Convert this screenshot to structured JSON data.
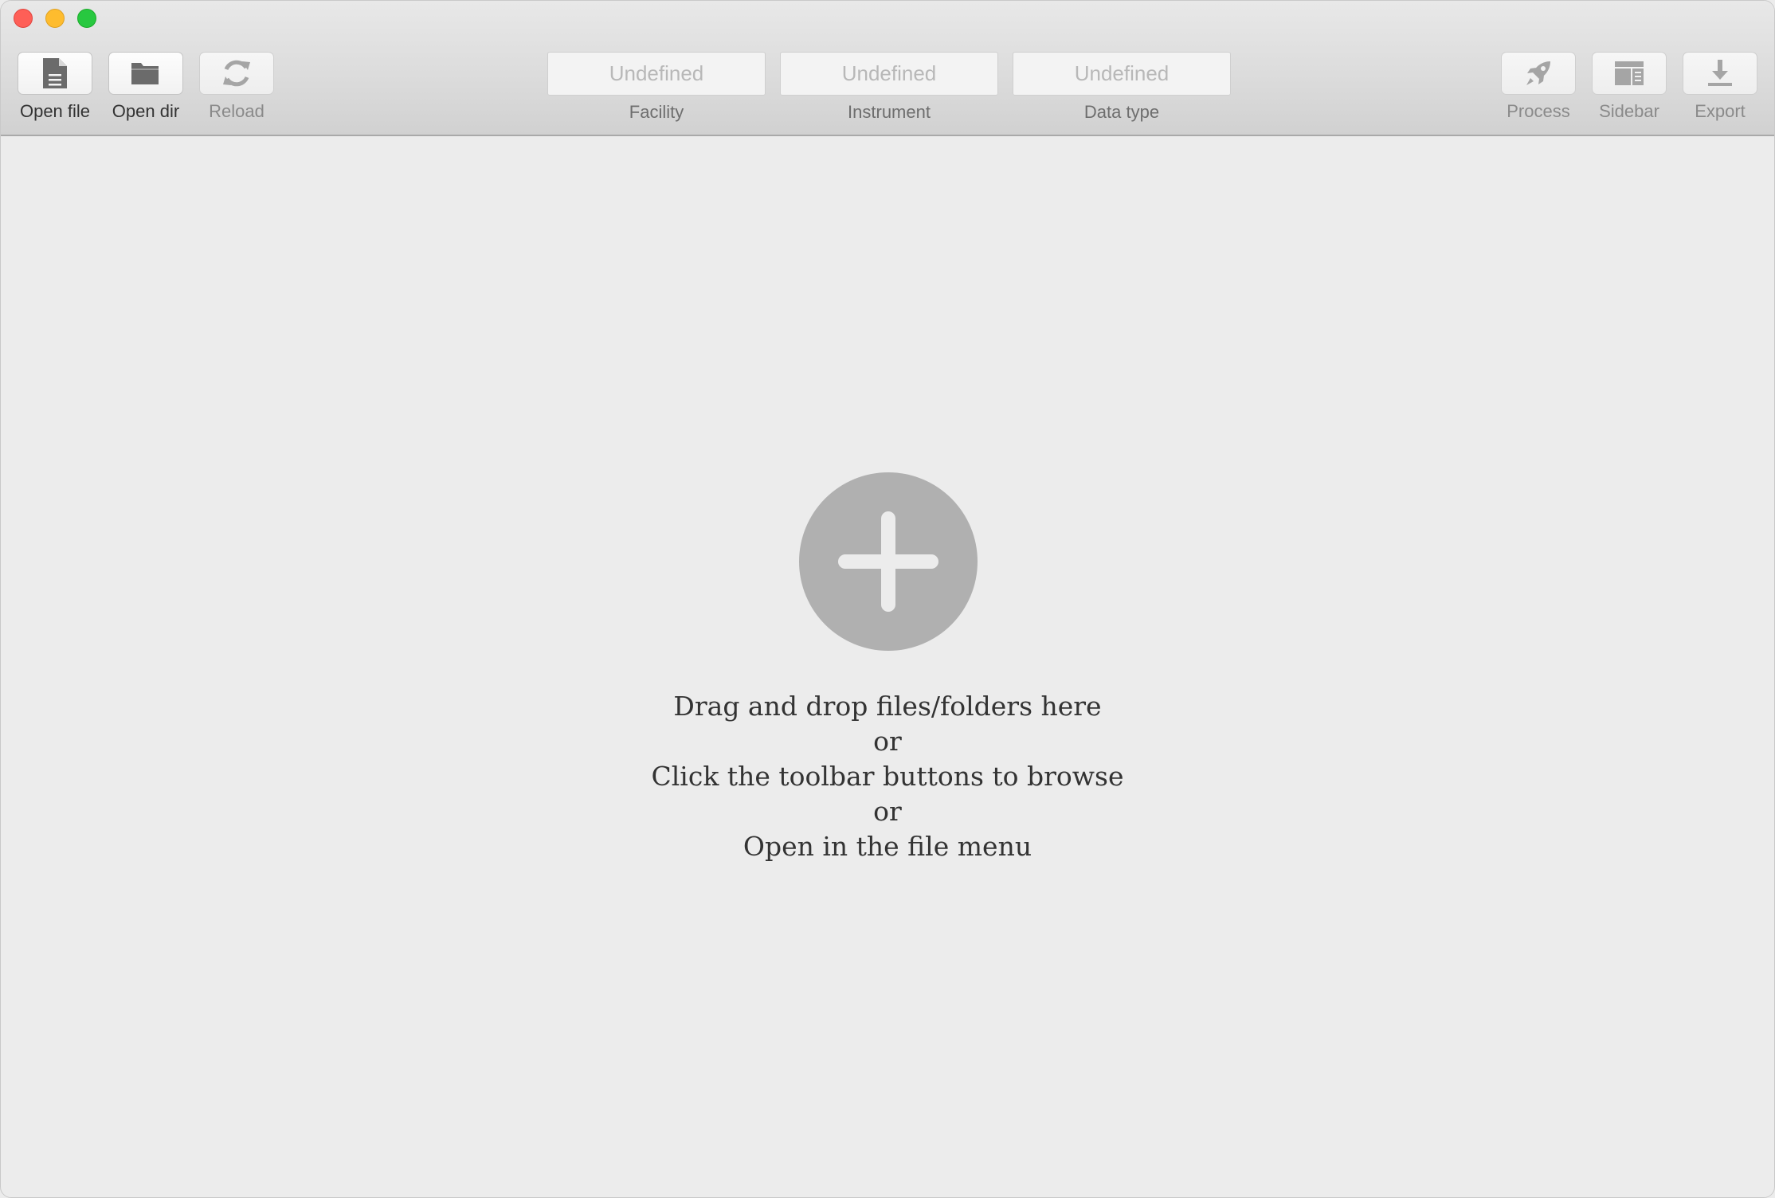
{
  "window": {
    "traffic_lights": [
      "close",
      "minimize",
      "maximize"
    ]
  },
  "toolbar": {
    "left": [
      {
        "label": "Open file",
        "icon": "document-icon",
        "enabled": true
      },
      {
        "label": "Open dir",
        "icon": "folder-icon",
        "enabled": true
      },
      {
        "label": "Reload",
        "icon": "refresh-icon",
        "enabled": false
      }
    ],
    "selectors": [
      {
        "value": "Undefined",
        "label": "Facility"
      },
      {
        "value": "Undefined",
        "label": "Instrument"
      },
      {
        "value": "Undefined",
        "label": "Data type"
      }
    ],
    "right": [
      {
        "label": "Process",
        "icon": "rocket-icon",
        "enabled": false
      },
      {
        "label": "Sidebar",
        "icon": "sidebar-icon",
        "enabled": false
      },
      {
        "label": "Export",
        "icon": "download-icon",
        "enabled": false
      }
    ]
  },
  "dropzone": {
    "icon": "plus-icon",
    "lines": [
      "Drag and drop files/folders here",
      "or",
      "Click the toolbar buttons to browse",
      "or",
      "Open in the file menu"
    ]
  },
  "colors": {
    "background": "#ececec",
    "icon_gray": "#b0b0b0",
    "close": "#fe5f57",
    "minimize": "#febc2e",
    "maximize": "#28c840"
  }
}
